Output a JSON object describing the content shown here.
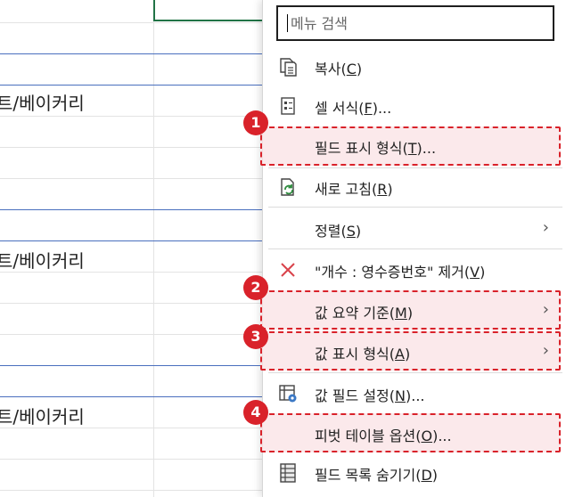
{
  "sheet": {
    "cells": [
      "트/베이커리",
      "트/베이커리",
      "트/베이커리"
    ]
  },
  "menu": {
    "search_placeholder": "메뉴 검색",
    "items": [
      {
        "label": "복사",
        "key": "C",
        "icon": "copy-icon"
      },
      {
        "label": "셀 서식",
        "key": "F",
        "suffix": "...",
        "icon": "format-cells-icon"
      },
      {
        "label": "필드 표시 형식",
        "key": "T",
        "suffix": "...",
        "icon": ""
      },
      {
        "label": "새로 고침",
        "key": "R",
        "icon": "refresh-icon"
      },
      {
        "label": "정렬",
        "key": "S",
        "icon": "",
        "submenu": true
      },
      {
        "label": "\"개수 : 영수증번호\" 제거",
        "key": "V",
        "icon": "remove-x-icon"
      },
      {
        "label": "값 요약 기준",
        "key": "M",
        "icon": "",
        "submenu": true
      },
      {
        "label": "값 표시 형식",
        "key": "A",
        "icon": "",
        "submenu": true
      },
      {
        "label": "값 필드 설정",
        "key": "N",
        "suffix": "...",
        "icon": "field-settings-icon"
      },
      {
        "label": "피벗 테이블 옵션",
        "key": "O",
        "suffix": "...",
        "icon": ""
      },
      {
        "label": "필드 목록 숨기기",
        "key": "D",
        "icon": "field-list-icon"
      }
    ]
  },
  "annotations": [
    "1",
    "2",
    "3",
    "4"
  ],
  "colors": {
    "highlight_border": "#d9222a",
    "highlight_fill": "#fae1e4",
    "grid_blue": "#4a6fbe",
    "selection_green": "#217346"
  }
}
